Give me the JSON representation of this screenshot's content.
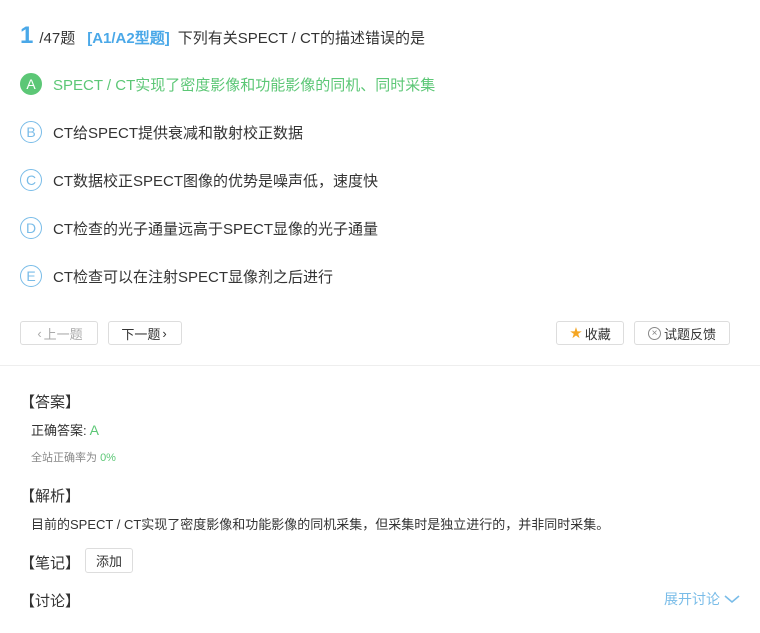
{
  "question": {
    "number": "1",
    "total": "/47题",
    "type": "[A1/A2型题]",
    "text": "下列有关SPECT / CT的描述错误的是"
  },
  "options": [
    {
      "letter": "A",
      "text": "SPECT / CT实现了密度影像和功能影像的同机、同时采集",
      "correct": true
    },
    {
      "letter": "B",
      "text": "CT给SPECT提供衰减和散射校正数据",
      "correct": false
    },
    {
      "letter": "C",
      "text": "CT数据校正SPECT图像的优势是噪声低，速度快",
      "correct": false
    },
    {
      "letter": "D",
      "text": "CT检查的光子通量远高于SPECT显像的光子通量",
      "correct": false
    },
    {
      "letter": "E",
      "text": "CT检查可以在注射SPECT显像剂之后进行",
      "correct": false
    }
  ],
  "nav": {
    "prev_label": "上一题",
    "next_label": "下一题",
    "favorite_label": "收藏",
    "report_label": "试题反馈"
  },
  "answer": {
    "title": "【答案】",
    "correct_label": "正确答案:",
    "correct_value": "A",
    "rate_label": "全站正确率为",
    "rate_value": "0%"
  },
  "analysis": {
    "title": "【解析】",
    "text": "目前的SPECT / CT实现了密度影像和功能影像的同机采集，但采集时是独立进行的，并非同时采集。"
  },
  "notes": {
    "title": "【笔记】",
    "add_label": "添加"
  },
  "discussion": {
    "title": "【讨论】",
    "expand_label": "展开讨论"
  },
  "colors": {
    "accent_blue": "#4aa8e8",
    "correct_green": "#5cc776",
    "star": "#f5a623"
  }
}
